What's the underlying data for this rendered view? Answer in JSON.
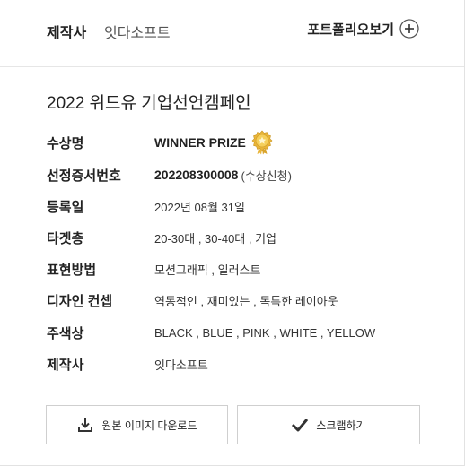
{
  "header": {
    "maker_label": "제작사",
    "maker_name": "잇다소프트",
    "portfolio_label": "포트폴리오보기",
    "portfolio_icon": "plus-circle-icon"
  },
  "title": "2022 위드유 기업선언캠페인",
  "details": {
    "award": {
      "label": "수상명",
      "value": "WINNER PRIZE",
      "icon": "gold-medal-icon"
    },
    "certificate": {
      "label": "선정증서번호",
      "value": "202208300008",
      "note": "(수상신청)"
    },
    "registered": {
      "label": "등록일",
      "value": "2022년 08월 31일"
    },
    "target": {
      "label": "타겟층",
      "value": "20-30대 , 30-40대 , 기업"
    },
    "method": {
      "label": "표현방법",
      "value": "모션그래픽 , 일러스트"
    },
    "concept": {
      "label": "디자인 컨셉",
      "value": "역동적인 , 재미있는 , 독특한 레이아웃"
    },
    "colors": {
      "label": "주색상",
      "value": "BLACK , BLUE , PINK , WHITE , YELLOW"
    },
    "maker": {
      "label": "제작사",
      "value": "잇다소프트"
    }
  },
  "actions": {
    "download_label": "원본 이미지 다운로드",
    "download_icon": "download-icon",
    "scrap_label": "스크랩하기",
    "scrap_icon": "checkmark-icon"
  },
  "colors": {
    "medal_gold": "#e9b53a",
    "border": "#cfcfcf",
    "divider": "#e6e6e6"
  }
}
